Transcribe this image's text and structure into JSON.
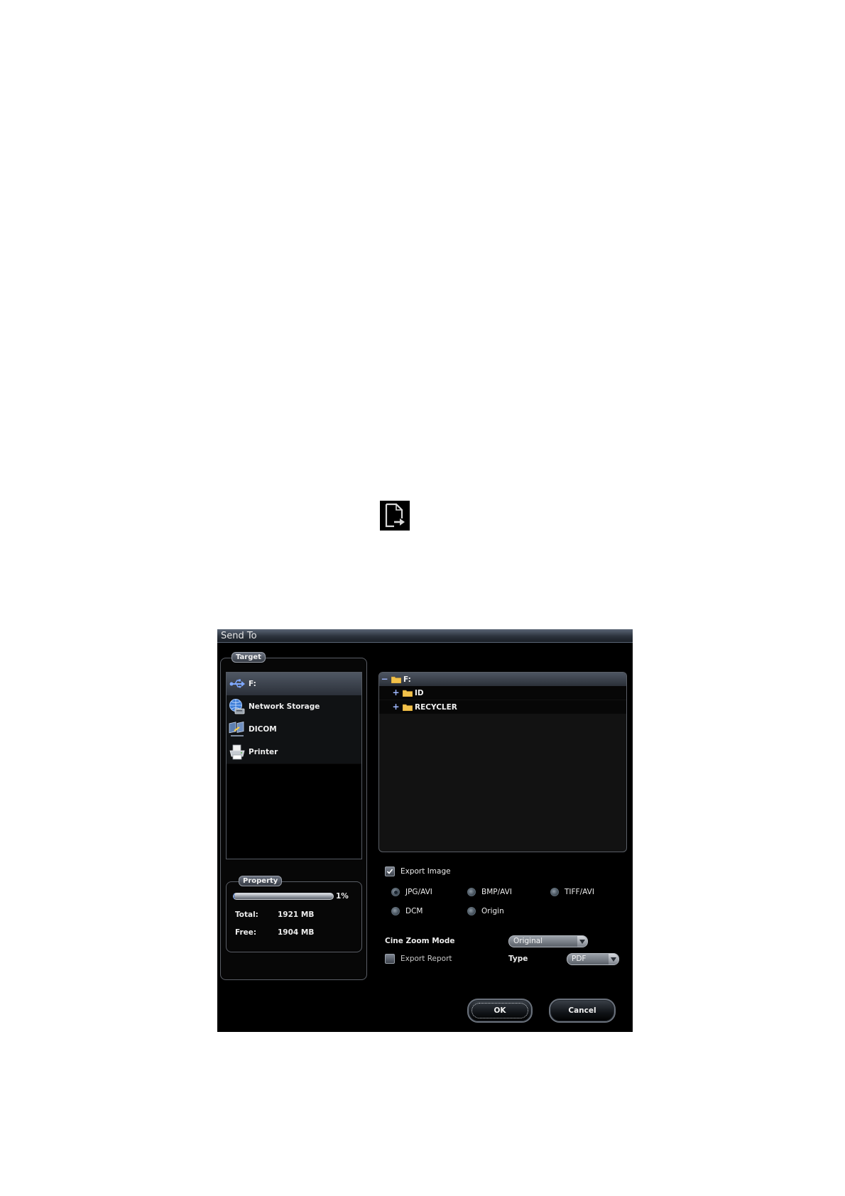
{
  "send_to_icon": {
    "icon": "send-to-icon"
  },
  "dialog": {
    "title": "Send To",
    "target": {
      "legend": "Target",
      "items": [
        {
          "label": "F:",
          "icon": "usb-drive-icon",
          "selected": true
        },
        {
          "label": "Network Storage",
          "icon": "network-storage-icon",
          "selected": false
        },
        {
          "label": "DICOM",
          "icon": "dicom-icon",
          "selected": false
        },
        {
          "label": "Printer",
          "icon": "printer-icon",
          "selected": false
        }
      ]
    },
    "property": {
      "legend": "Property",
      "usage_percent_label": "1%",
      "usage_fraction": 0.01,
      "total_label": "Total:",
      "total_value": "1921 MB",
      "free_label": "Free:",
      "free_value": "1904 MB"
    },
    "tree": {
      "root": {
        "label": "F:",
        "expander": "−",
        "icon": "folder-icon"
      },
      "children": [
        {
          "label": "ID",
          "expander": "+",
          "icon": "folder-icon"
        },
        {
          "label": "RECYCLER",
          "expander": "+",
          "icon": "folder-icon"
        }
      ]
    },
    "export_image": {
      "label": "Export Image",
      "checked": true
    },
    "formats": [
      {
        "label": "JPG/AVI",
        "checked": true
      },
      {
        "label": "BMP/AVI",
        "checked": false
      },
      {
        "label": "TIFF/AVI",
        "checked": false
      },
      {
        "label": "DCM",
        "checked": false
      },
      {
        "label": "Origin",
        "checked": false
      }
    ],
    "cine_zoom": {
      "label": "Cine Zoom Mode",
      "value": "Original"
    },
    "export_report": {
      "label": "Export Report",
      "checked": false
    },
    "report_type": {
      "label": "Type",
      "value": "PDF"
    },
    "buttons": {
      "ok": "OK",
      "cancel": "Cancel"
    },
    "colors": {
      "selection_top": "#4f5763",
      "background": "#000000",
      "border": "#5a5e66"
    }
  }
}
